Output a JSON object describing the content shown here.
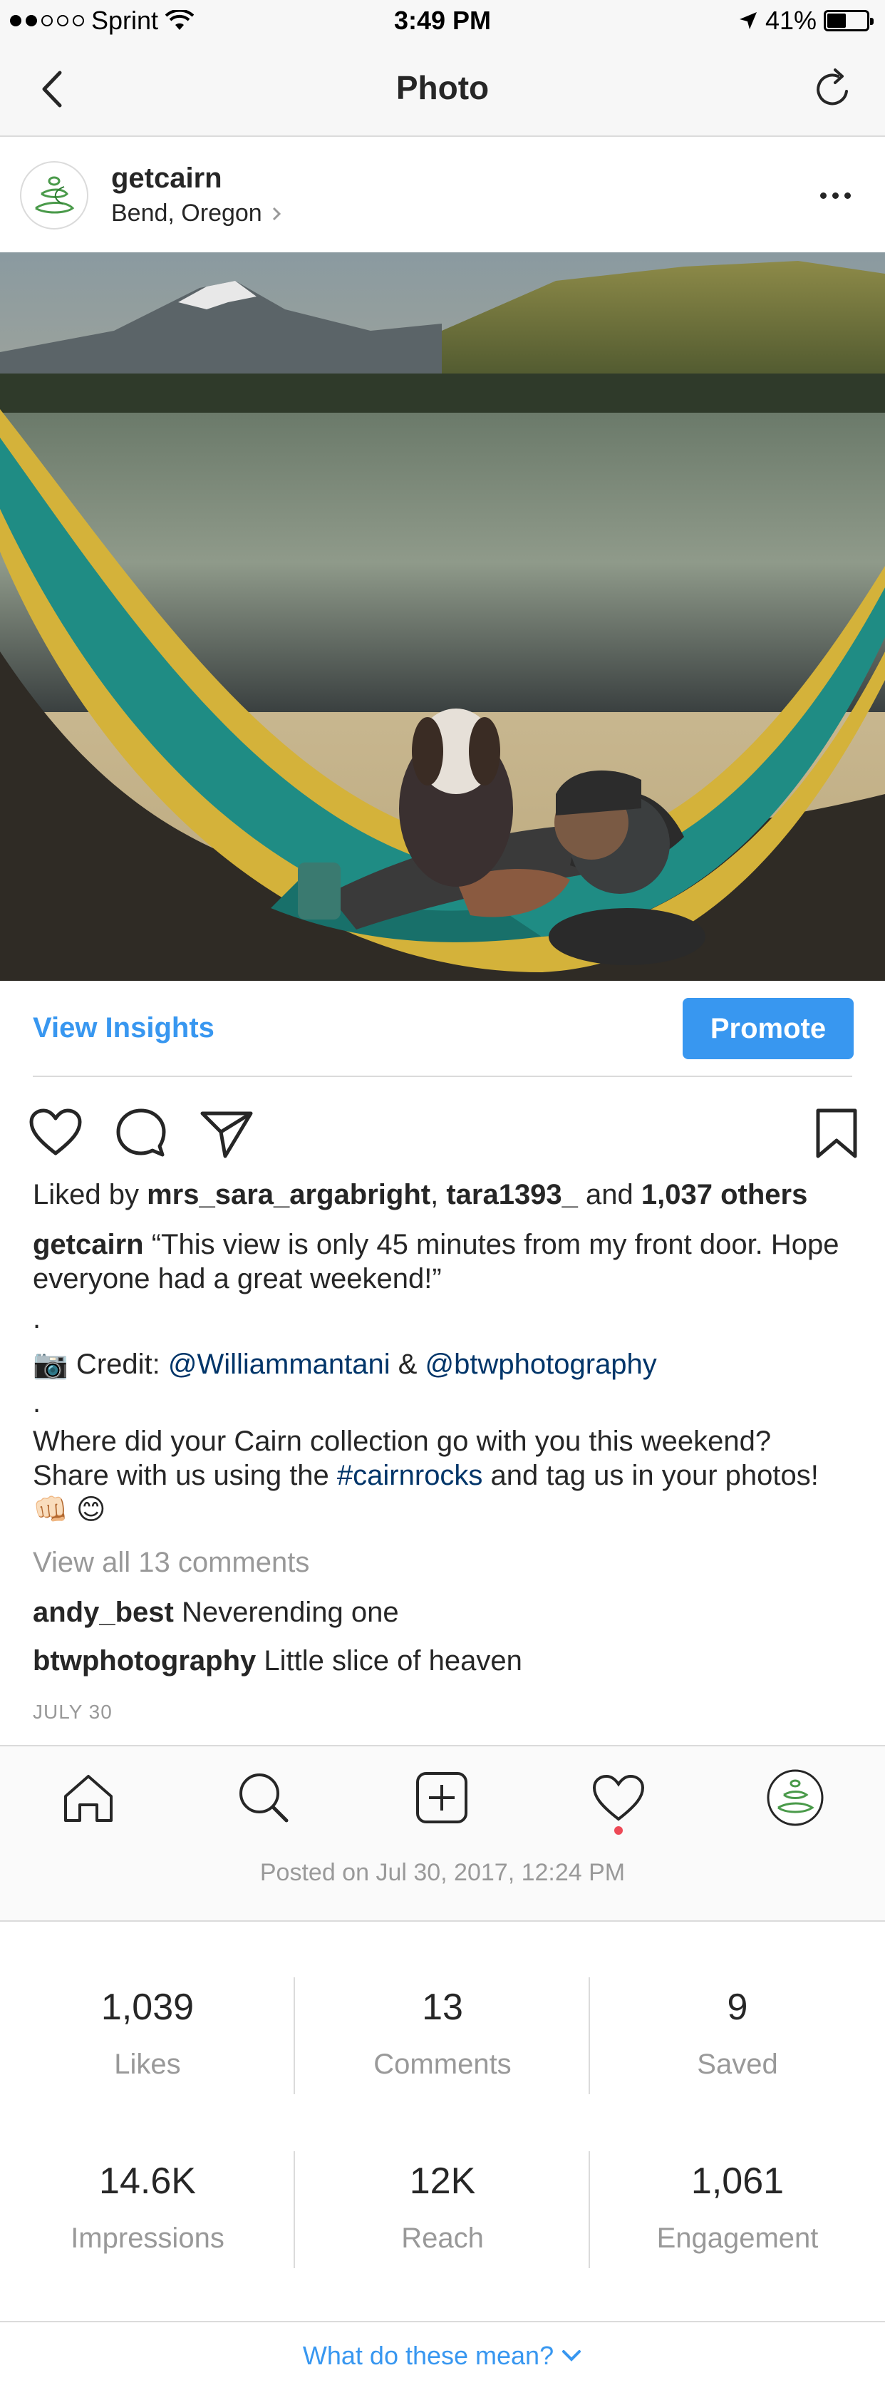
{
  "status_bar": {
    "carrier": "Sprint",
    "time": "3:49 PM",
    "battery": "41%"
  },
  "nav": {
    "title": "Photo"
  },
  "post": {
    "username": "getcairn",
    "location": "Bend, Oregon",
    "view_insights": "View Insights",
    "promote": "Promote",
    "likes_prefix": "Liked by ",
    "liker_1": "mrs_sara_argabright",
    "likes_sep": ", ",
    "liker_2": "tara1393_",
    "likes_and": " and ",
    "likes_others": "1,037 others",
    "caption_user": "getcairn",
    "caption_line1": " “This view is only 45 minutes from my front door. Hope everyone had a great weekend!”",
    "caption_dot1": ".",
    "credit_emoji": "📷",
    "credit_label": " Credit: ",
    "credit_handle_1": "@Williammantani",
    "credit_amp": " & ",
    "credit_handle_2": "@btwphotography",
    "caption_dot2": ".",
    "caption_question": "Where did your Cairn collection go with you this weekend? Share with us using the ",
    "caption_hashtag": "#cairnrocks",
    "caption_tail": " and tag us in your photos! 👊🏻 😊",
    "view_all_comments": "View all 13 comments",
    "comments": [
      {
        "user": "andy_best",
        "text": " Neverending one"
      },
      {
        "user": "btwphotography",
        "text": " Little slice of heaven"
      }
    ],
    "date": "JULY 30",
    "posted_on": "Posted on Jul 30, 2017, 12:24 PM"
  },
  "stats": [
    {
      "value": "1,039",
      "label": "Likes"
    },
    {
      "value": "13",
      "label": "Comments"
    },
    {
      "value": "9",
      "label": "Saved"
    },
    {
      "value": "14.6K",
      "label": "Impressions"
    },
    {
      "value": "12K",
      "label": "Reach"
    },
    {
      "value": "1,061",
      "label": "Engagement"
    }
  ],
  "help_link": "What do these mean?",
  "icons": {
    "back": "chevron-left-icon",
    "refresh": "refresh-icon",
    "more": "more-horizontal-icon",
    "like": "heart-icon",
    "comment": "comment-bubble-icon",
    "share": "send-paper-plane-icon",
    "save": "bookmark-icon",
    "tabs": [
      "home-icon",
      "search-icon",
      "add-post-icon",
      "activity-heart-icon",
      "profile-avatar-icon"
    ]
  },
  "colors": {
    "accent": "#3897f0",
    "link": "#003569",
    "muted": "#999999",
    "text": "#262626",
    "notification": "#ed4956"
  }
}
